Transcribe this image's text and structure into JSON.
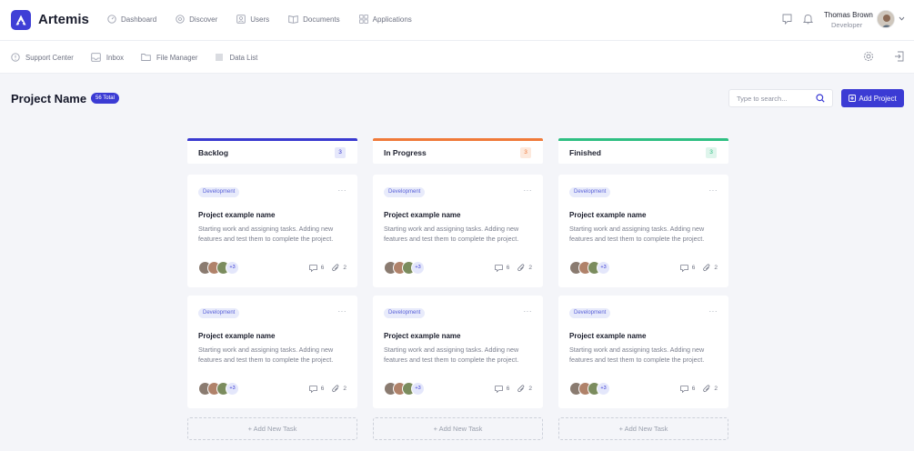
{
  "app": {
    "brand": "Artemis"
  },
  "nav": [
    {
      "label": "Dashboard",
      "icon": "dashboard-icon"
    },
    {
      "label": "Discover",
      "icon": "compass-icon"
    },
    {
      "label": "Users",
      "icon": "user-icon"
    },
    {
      "label": "Documents",
      "icon": "book-icon"
    },
    {
      "label": "Applications",
      "icon": "grid-icon"
    }
  ],
  "user": {
    "name": "Thomas Brown",
    "role": "Developer"
  },
  "subnav": [
    {
      "label": "Support Center",
      "icon": "help-icon"
    },
    {
      "label": "Inbox",
      "icon": "inbox-icon"
    },
    {
      "label": "File Manager",
      "icon": "folder-icon"
    },
    {
      "label": "Data List",
      "icon": "list-icon"
    }
  ],
  "page": {
    "title": "Project Name",
    "total_badge": "56 Total",
    "search_placeholder": "Type to search...",
    "add_project_label": "Add Project"
  },
  "colors": {
    "accent": "#3b3bd4",
    "backlog": "#3a3ad0",
    "in_progress": "#f07a3a",
    "finished": "#2fbf83"
  },
  "columns": [
    {
      "title": "Backlog",
      "count": "3",
      "add_task_label": "+ Add New Task",
      "cards": [
        {
          "tag": "Development",
          "more": "···",
          "title": "Project example name",
          "description": "Starting work and assigning tasks. Adding new features and test them to complete the project.",
          "more_members": "+3",
          "comments": "6",
          "attachments": "2"
        },
        {
          "tag": "Development",
          "more": "···",
          "title": "Project example name",
          "description": "Starting work and assigning tasks. Adding new features and test them to complete the project.",
          "more_members": "+3",
          "comments": "6",
          "attachments": "2"
        }
      ]
    },
    {
      "title": "In Progress",
      "count": "3",
      "add_task_label": "+ Add New Task",
      "cards": [
        {
          "tag": "Development",
          "more": "···",
          "title": "Project example name",
          "description": "Starting work and assigning tasks. Adding new features and test them to complete the project.",
          "more_members": "+3",
          "comments": "6",
          "attachments": "2"
        },
        {
          "tag": "Development",
          "more": "···",
          "title": "Project example name",
          "description": "Starting work and assigning tasks. Adding new features and test them to complete the project.",
          "more_members": "+3",
          "comments": "6",
          "attachments": "2"
        }
      ]
    },
    {
      "title": "Finished",
      "count": "3",
      "add_task_label": "+ Add New Task",
      "cards": [
        {
          "tag": "Development",
          "more": "···",
          "title": "Project example name",
          "description": "Starting work and assigning tasks. Adding new features and test them to complete the project.",
          "more_members": "+3",
          "comments": "6",
          "attachments": "2"
        },
        {
          "tag": "Development",
          "more": "···",
          "title": "Project example name",
          "description": "Starting work and assigning tasks. Adding new features and test them to complete the project.",
          "more_members": "+3",
          "comments": "6",
          "attachments": "2"
        }
      ]
    }
  ]
}
